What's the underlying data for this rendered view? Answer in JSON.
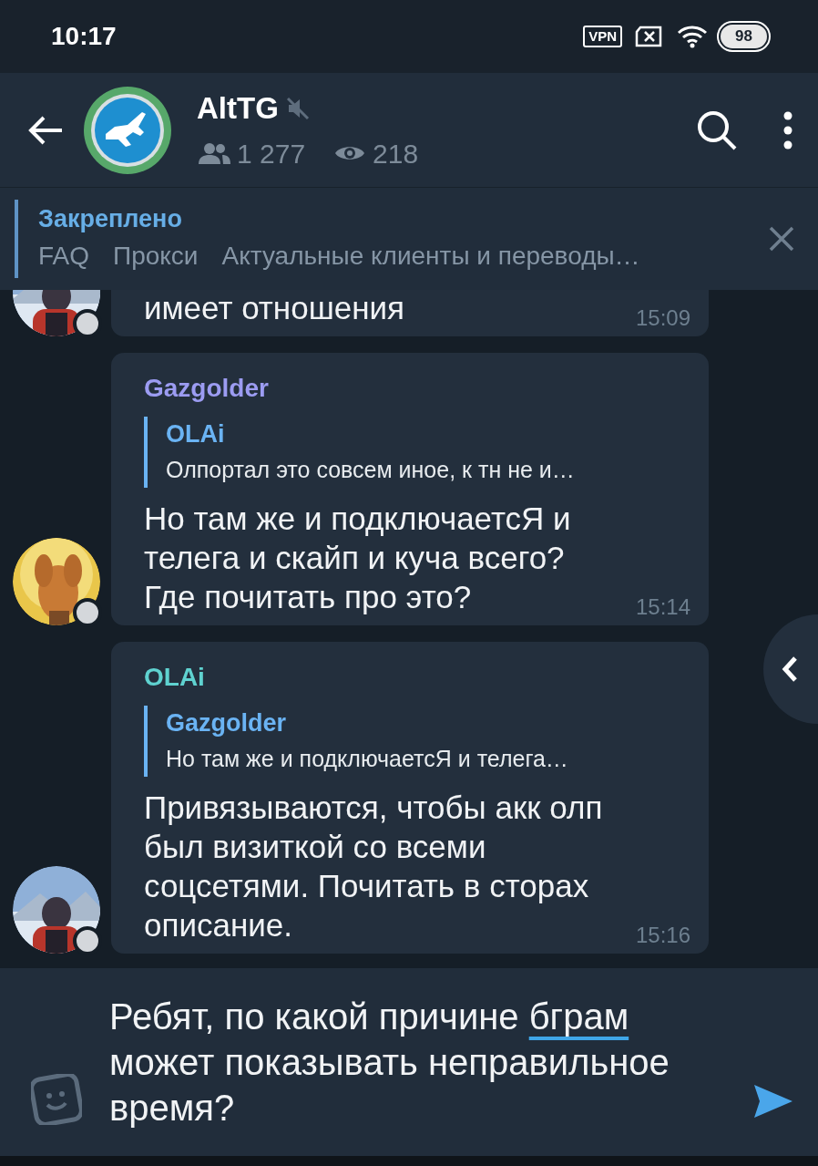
{
  "status_bar": {
    "time": "10:17",
    "vpn": "VPN",
    "battery": "98"
  },
  "header": {
    "title": "AltTG",
    "muted": true,
    "members": "1 277",
    "views": "218"
  },
  "pinned": {
    "label": "Закреплено",
    "items": [
      "FAQ",
      "Прокси",
      "Актуальные клиенты и переводы…"
    ]
  },
  "messages": [
    {
      "text": "имеет отношения",
      "time": "15:09"
    },
    {
      "sender": "Gazgolder",
      "color": "#9c9cf2",
      "reply": {
        "author": "OLAi",
        "color": "#6ab3f3",
        "text": "Олпортал это совсем иное, к тн не и…"
      },
      "text": "Но там же и подключаетсЯ и телега и скайп и куча всего? Где почитать про это?",
      "time": "15:14"
    },
    {
      "sender": "OLAi",
      "color": "#5fd2d0",
      "reply": {
        "author": "Gazgolder",
        "color": "#6ab3f3",
        "text": "Но там же и подключаетсЯ и телега…"
      },
      "text": "Привязываются, чтобы акк олп был визиткой со всеми соцсетями. Почитать в сторах описание.",
      "time": "15:16"
    }
  ],
  "composer": {
    "parts": [
      {
        "text": "Ребят, по какой причине "
      },
      {
        "text": "бграм",
        "misspelled": true
      },
      {
        "text": " может показывать неправильное время?"
      }
    ]
  }
}
